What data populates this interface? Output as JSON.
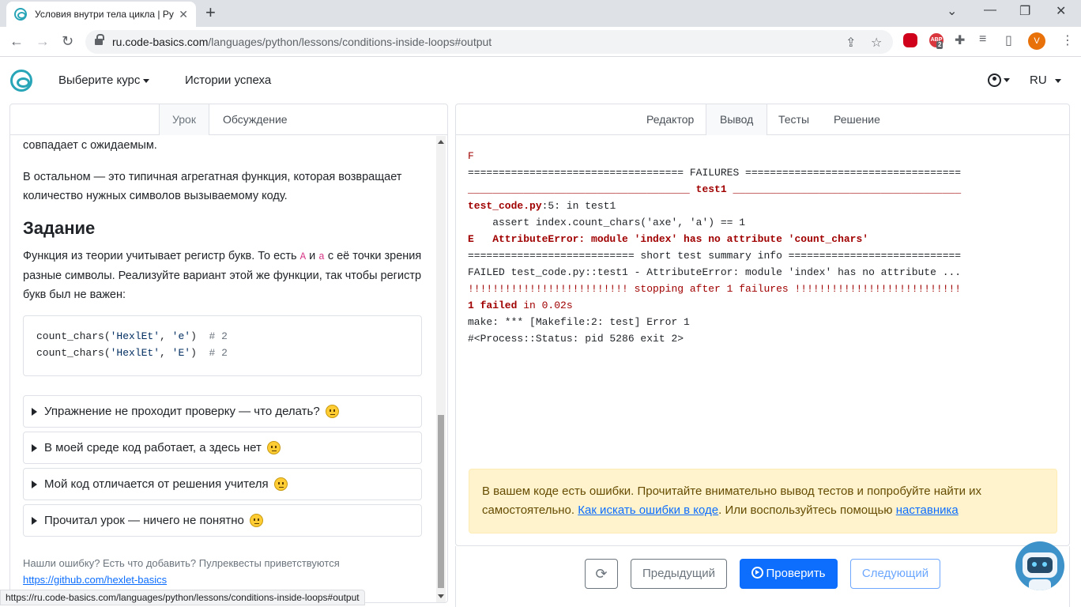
{
  "browser": {
    "tab_title": "Условия внутри тела цикла | Pyt",
    "tab_close": "✕",
    "new_tab": "+",
    "url_host": "ru.code-basics.com",
    "url_path": "/languages/python/lessons/conditions-inside-loops#output",
    "ext_abp_label": "ABP",
    "ext_abp_count": "2",
    "profile_initial": "V",
    "status_url": "https://ru.code-basics.com/languages/python/lessons/conditions-inside-loops#output"
  },
  "header": {
    "choose_course": "Выберите курс",
    "success_stories": "Истории успеха",
    "language": "RU"
  },
  "left_tabs": {
    "lesson": "Урок",
    "discussion": "Обсуждение"
  },
  "lesson": {
    "top_line": "совпадает с ожидаемым.",
    "para1": "В остальном — это типичная агрегатная функция, которая возвращает количество нужных символов вызываемому коду.",
    "task_heading": "Задание",
    "task_part1": "Функция из теории учитывает регистр букв. То есть ",
    "task_code1": "A",
    "task_and": " и ",
    "task_code2": "a",
    "task_part2": " с её точки зрения разные символы. Реализуйте вариант этой же функции, так чтобы регистр букв был не важен:",
    "code_lines": [
      {
        "fn": "count_chars(",
        "s1": "'HexlEt'",
        "sep": ", ",
        "s2": "'e'",
        "close": ")  ",
        "cmt": "# 2"
      },
      {
        "fn": "count_chars(",
        "s1": "'HexlEt'",
        "sep": ", ",
        "s2": "'E'",
        "close": ")  ",
        "cmt": "# 2"
      }
    ],
    "accordions": [
      "Упражнение не проходит проверку — что делать?",
      "В моей среде код работает, а здесь нет",
      "Мой код отличается от решения учителя",
      "Прочитал урок — ничего не понятно"
    ],
    "footer_text": "Нашли ошибку? Есть что добавить? Пулреквесты приветствуются",
    "footer_link": "https://github.com/hexlet-basics"
  },
  "right_tabs": {
    "editor": "Редактор",
    "output": "Вывод",
    "tests": "Тесты",
    "solution": "Решение"
  },
  "output": {
    "line1": "F",
    "line2": "=================================== FAILURES ===================================",
    "line3_pre": "____________________________________ ",
    "line3_name": "test1",
    "line3_post": " _____________________________________",
    "line4_file": "test_code.py",
    "line4_rest": ":5: in test1",
    "line5": "    assert index.count_chars('axe', 'a') == 1",
    "line6": "E   AttributeError: module 'index' has no attribute 'count_chars'",
    "line7": "=========================== short test summary info ============================",
    "line8": "FAILED test_code.py::test1 - AttributeError: module 'index' has no attribute ...",
    "line9": "!!!!!!!!!!!!!!!!!!!!!!!!!! stopping after 1 failures !!!!!!!!!!!!!!!!!!!!!!!!!!!",
    "line10_failed": "1 failed",
    "line10_rest": " in 0.02s",
    "line11": "make: *** [Makefile:2: test] Error 1",
    "line12": "#<Process::Status: pid 5286 exit 2>"
  },
  "alert": {
    "text1": "В вашем коде есть ошибки. Прочитайте внимательно вывод тестов и попробуйте найти их самостоятельно. ",
    "link1": "Как искать ошибки в коде",
    "text2": ". Или воспользуйтесь помощью ",
    "link2": "наставника"
  },
  "buttons": {
    "refresh": "⟳",
    "prev": "Предыдущий",
    "check": "Проверить",
    "next": "Следующий"
  }
}
